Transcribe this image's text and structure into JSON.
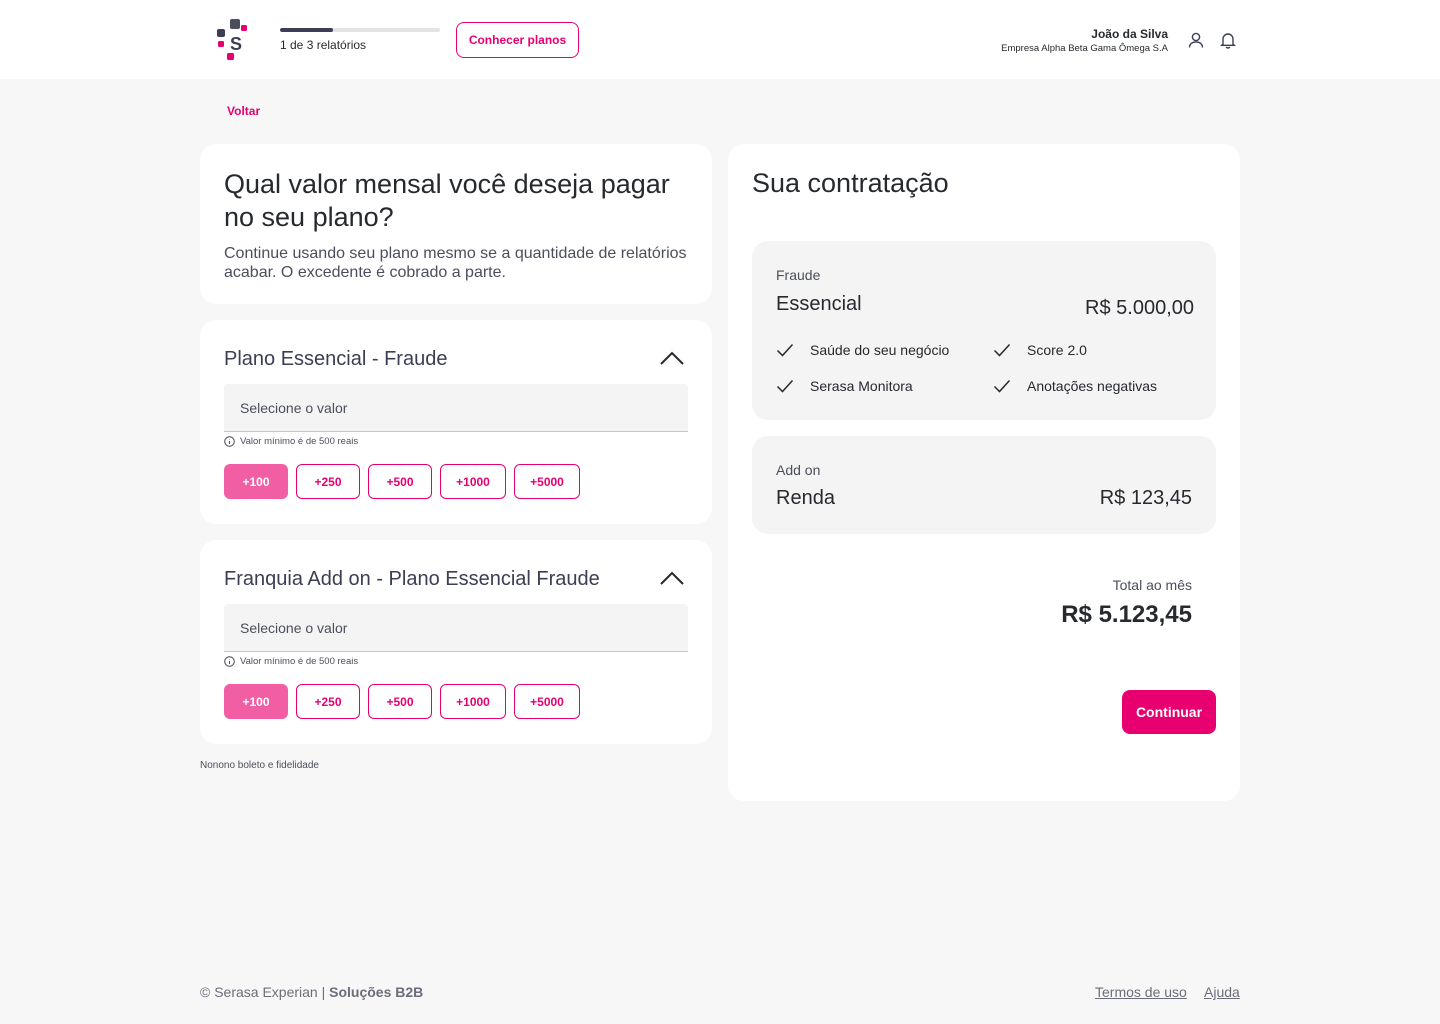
{
  "header": {
    "logo_icon": "serasa-logo-icon",
    "progress": {
      "current": 1,
      "total": 3,
      "fraction": 0.33,
      "label": "1 de 3 relatórios"
    },
    "plans_button": "Conhecer planos",
    "user": {
      "name": "João da Silva",
      "company": "Empresa Alpha Beta Gama Ômega S.A"
    },
    "icons": [
      "user-icon",
      "bell-icon"
    ]
  },
  "nav": {
    "back": "Voltar"
  },
  "intro": {
    "title": "Qual valor mensal você deseja pagar no seu plano?",
    "description": "Continue usando seu plano mesmo se a quantidade de relatórios acabar. O excedente é cobrado a parte."
  },
  "plans": [
    {
      "title": "Plano Essencial - Fraude",
      "select_placeholder": "Selecione o valor",
      "hint": "Valor mínimo é de 500 reais",
      "chips": [
        "+100",
        "+250",
        "+500",
        "+1000",
        "+5000"
      ],
      "active_chip": 0
    },
    {
      "title": "Franquia Add on - Plano Essencial Fraude",
      "select_placeholder": "Selecione o valor",
      "hint": "Valor mínimo é de 500 reais",
      "chips": [
        "+100",
        "+250",
        "+500",
        "+1000",
        "+5000"
      ],
      "active_chip": 0
    }
  ],
  "footnote": "Nonono boleto e fidelidade",
  "summary": {
    "title": "Sua contratação",
    "fraud": {
      "category": "Fraude",
      "name": "Essencial",
      "price": "R$ 5.000,00",
      "features": [
        "Saúde do seu negócio",
        "Score 2.0",
        "Serasa Monitora",
        "Anotações negativas"
      ]
    },
    "addon": {
      "category": "Add on",
      "name": "Renda",
      "price": "R$ 123,45"
    },
    "total_label": "Total ao mês",
    "total_value": "R$ 5.123,45",
    "continue": "Continuar"
  },
  "footer": {
    "copyright": "© Serasa Experian | ",
    "brand": "Soluções B2B",
    "links": [
      "Termos de uso",
      "Ajuda"
    ]
  },
  "colors": {
    "accent": "#e80070",
    "accent_light": "#f25ea3",
    "dark": "#3b3e54",
    "background": "#f7f7f7"
  }
}
